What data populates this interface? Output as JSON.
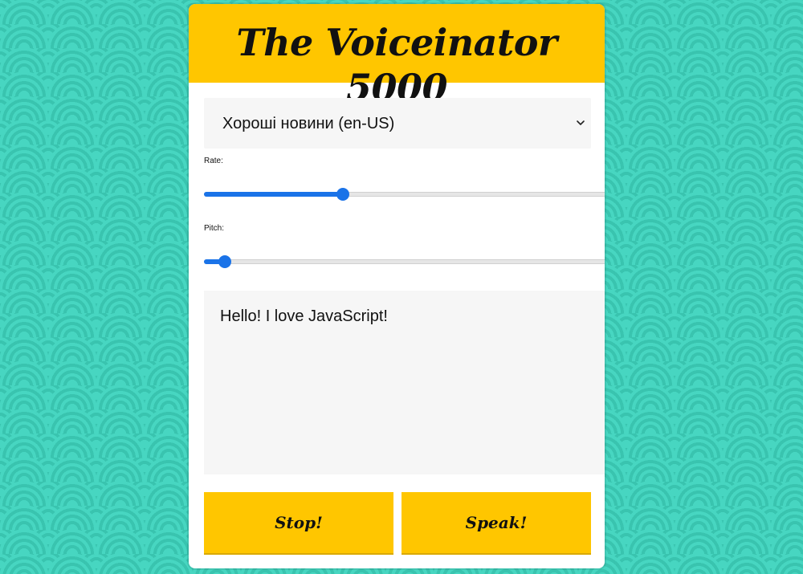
{
  "app": {
    "title": "The Voiceinator 5000"
  },
  "voice_select": {
    "selected": "Хороші новини (en-US)",
    "icon": "chevron-down-icon"
  },
  "rate": {
    "label": "Rate:",
    "min": 0,
    "max": 3,
    "value": 1
  },
  "pitch": {
    "label": "Pitch:",
    "min": 0,
    "max": 2,
    "value": 0.1
  },
  "text": {
    "value": "Hello! I love JavaScript!"
  },
  "buttons": {
    "stop_label": "Stop!",
    "speak_label": "Speak!"
  },
  "colors": {
    "accent": "#ffc600",
    "background": "#3cc8b4",
    "slider": "#1a73e8",
    "field": "#f6f6f6"
  }
}
